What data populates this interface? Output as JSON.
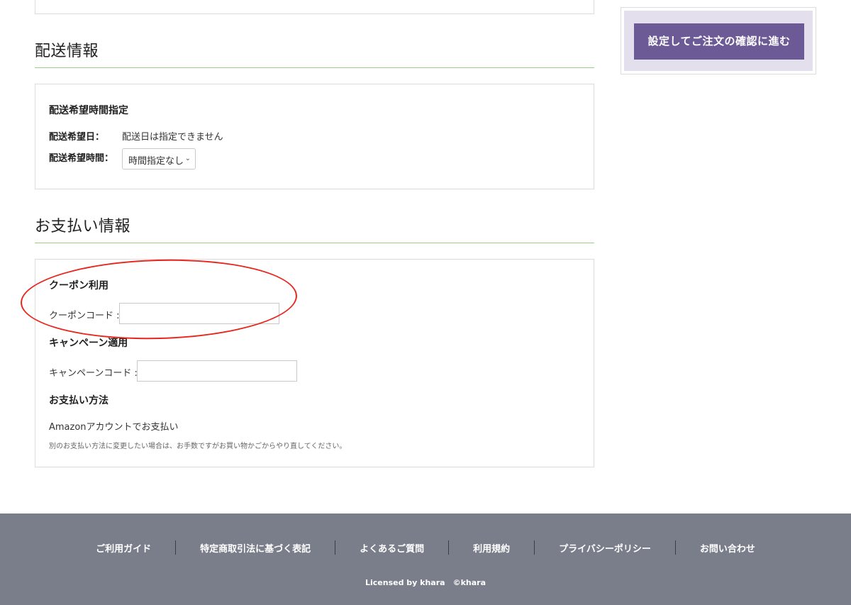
{
  "delivery": {
    "title": "配送情報",
    "panel_title": "配送希望時間指定",
    "date_label": "配送希望日：",
    "date_value": "配送日は指定できません",
    "time_label": "配送希望時間：",
    "time_select_value": "時間指定なし"
  },
  "payment": {
    "title": "お支払い情報",
    "coupon_title": "クーポン利用",
    "coupon_label": "クーポンコード :",
    "coupon_value": "",
    "campaign_title": "キャンペーン適用",
    "campaign_label": "キャンペーンコード :",
    "campaign_value": "",
    "method_title": "お支払い方法",
    "method_value": "Amazonアカウントでお支払い",
    "method_note": "別のお支払い方法に変更したい場合は、お手数ですがお買い物かごからやり直してください。"
  },
  "sidebar": {
    "confirm_button": "設定してご注文の確認に進む"
  },
  "footer": {
    "links": [
      "ご利用ガイド",
      "特定商取引法に基づく表記",
      "よくあるご質問",
      "利用規約",
      "プライバシーポリシー",
      "お問い合わせ"
    ],
    "copyright": "Licensed by khara　©khara"
  },
  "colors": {
    "accent_line": "#9ccf86",
    "button_bg": "#6c5a96",
    "footer_bg": "#7a7e8a",
    "annotation": "#e8261d"
  }
}
